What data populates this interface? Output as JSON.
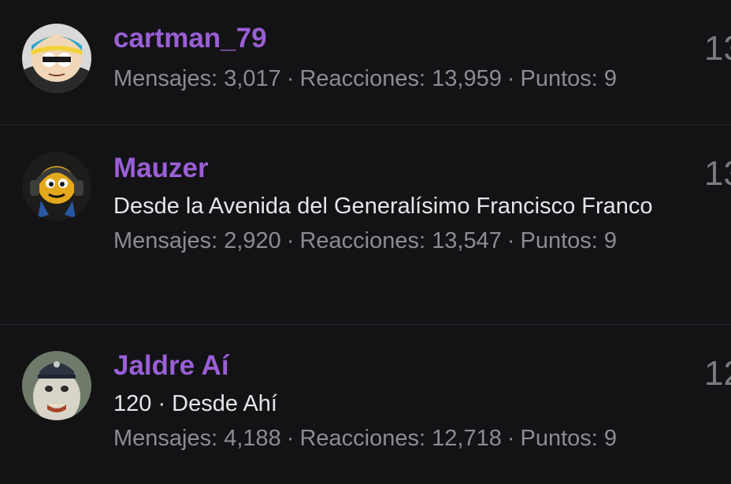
{
  "members": [
    {
      "username": "cartman_79",
      "title": "",
      "stats": {
        "posts_label": "Mensajes:",
        "posts": "3,017",
        "reactions_label": "Reacciones:",
        "reactions": "13,959",
        "points_label": "Puntos:",
        "points": "9"
      },
      "right_value": "13"
    },
    {
      "username": "Mauzer",
      "title": "Desde la Avenida del Generalísimo Francisco Franco",
      "stats": {
        "posts_label": "Mensajes:",
        "posts": "2,920",
        "reactions_label": "Reacciones:",
        "reactions": "13,547",
        "points_label": "Puntos:",
        "points": "9"
      },
      "right_value": "13"
    },
    {
      "username": "Jaldre Aí",
      "title": "120 · Desde Ahí",
      "stats": {
        "posts_label": "Mensajes:",
        "posts": "4,188",
        "reactions_label": "Reacciones:",
        "reactions": "12,718",
        "points_label": "Puntos:",
        "points": "9"
      },
      "right_value": "12"
    }
  ],
  "stat_separator": "·",
  "colors": {
    "background": "#131315",
    "username": "#9a5fd6",
    "title_text": "#e6e6ea",
    "stats_text": "#8c8c94",
    "divider": "#26262a"
  }
}
